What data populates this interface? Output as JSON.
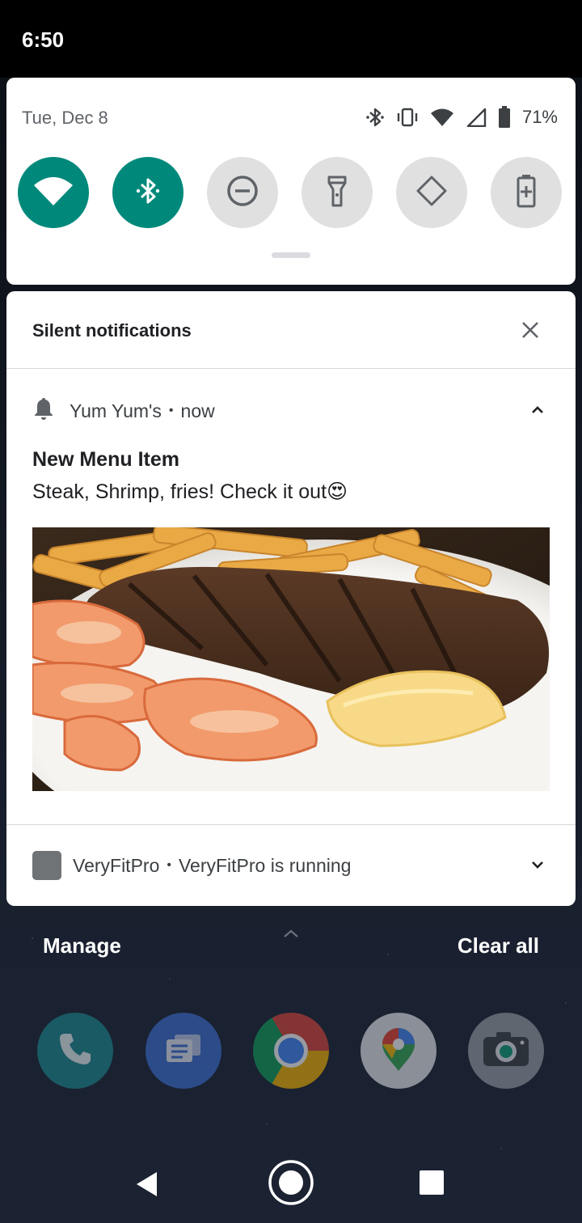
{
  "status_bar": {
    "time": "6:50"
  },
  "quick_settings": {
    "date": "Tue, Dec 8",
    "battery_percent": "71%",
    "tiles": [
      {
        "name": "wifi",
        "on": true
      },
      {
        "name": "bluetooth",
        "on": true
      },
      {
        "name": "do-not-disturb",
        "on": false
      },
      {
        "name": "flashlight",
        "on": false
      },
      {
        "name": "auto-rotate",
        "on": false
      },
      {
        "name": "battery-saver",
        "on": false
      }
    ]
  },
  "notifications": {
    "section_title": "Silent notifications",
    "items": [
      {
        "app": "Yum Yum's",
        "time": "now",
        "title": "New Menu Item",
        "body": "Steak, Shrimp, fries! Check it out",
        "emoji": "😍",
        "expanded": true
      },
      {
        "app": "VeryFitPro",
        "text": "VeryFitPro is running",
        "expanded": false
      }
    ]
  },
  "actions": {
    "manage": "Manage",
    "clear_all": "Clear all"
  },
  "colors": {
    "accent": "#00897b",
    "panel": "#ffffff",
    "tile_off": "#e0e0e0"
  },
  "dock": [
    "phone",
    "messages",
    "chrome",
    "maps",
    "camera"
  ]
}
